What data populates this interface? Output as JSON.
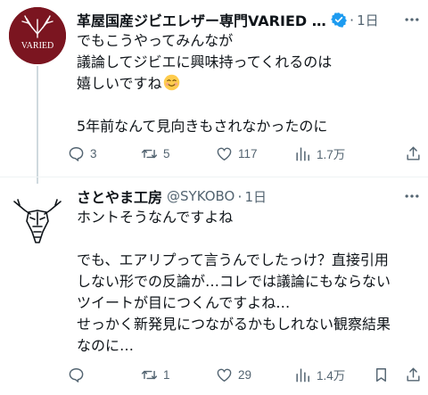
{
  "tweets": [
    {
      "name": "革屋国産ジビエレザー専門VARIED (…",
      "verified": true,
      "time": "1日",
      "avatar_text": "VARIED",
      "lines": [
        "でもこうやってみんなが",
        "議論してジビエに興味持ってくれるのは",
        "嬉しいですね",
        "",
        "5年前なんて見向きもされなかったのに"
      ],
      "emoji": "smiling-face-icon",
      "actions": {
        "replies": "3",
        "retweets": "5",
        "likes": "117",
        "views": "1.7万"
      }
    },
    {
      "name": "さとやま工房",
      "handle": "@SYKOBO",
      "time": "1日",
      "lines": [
        "ホントそうなんですよね",
        "",
        "でも、エアリプって言うんでしたっけ？直接引用",
        "しない形での反論が…コレでは議論にもならない",
        "ツイートが目につくんですよね…",
        "せっかく新発見につながるかもしれない観察結果",
        "なのに…"
      ],
      "actions": {
        "replies": "",
        "retweets": "1",
        "likes": "29",
        "views": "1.4万"
      }
    }
  ],
  "colors": {
    "text": "#0f1419",
    "muted": "#536471",
    "verified": "#1d9bf0",
    "avatar_bg": "#7b1520"
  }
}
